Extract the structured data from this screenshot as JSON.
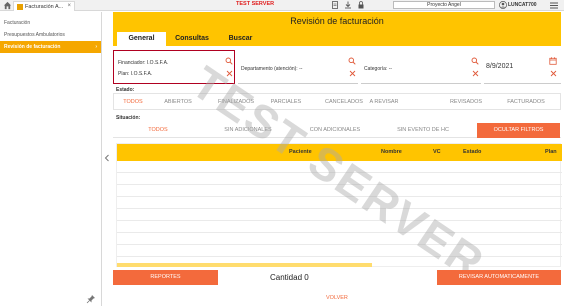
{
  "topbar": {
    "tab_label": "Facturación A...",
    "tab_close": "×",
    "server_label": "TEST SERVER",
    "project": "Proyecto Angel",
    "user": "LUNCAT700"
  },
  "sidebar": {
    "items": [
      {
        "label": "Facturación"
      },
      {
        "label": "Presupuestos Ambulatorios"
      },
      {
        "label": "Revisión de facturación",
        "arrow": "›"
      }
    ]
  },
  "main": {
    "title": "Revisión de facturación",
    "tabs": [
      {
        "label": "General"
      },
      {
        "label": "Consultas"
      },
      {
        "label": "Buscar"
      }
    ]
  },
  "filters": {
    "financiador": "Financiador: I.O.S.F.A.",
    "plan": "Plan: I.O.S.F.A.",
    "departamento": "Departamento (atención): --",
    "categoria": "Categoría: --",
    "fecha": "8/9/2021"
  },
  "estado": {
    "label": "Estado:",
    "options": [
      "TODOS",
      "ABIERTOS",
      "FINALIZADOS",
      "PARCIALES",
      "CANCELADOS",
      "A REVISAR",
      "REVISADOS",
      "FACTURADOS"
    ]
  },
  "situacion": {
    "label": "Situación:",
    "options": [
      "TODOS",
      "SIN ADICIONALES",
      "CON ADICIONALES",
      "SIN EVENTO DE HC"
    ],
    "hide_button": "OCULTAR FILTROS"
  },
  "table": {
    "columns": [
      "Paciente",
      "Nombre",
      "VC",
      "Estado",
      "Plan"
    ]
  },
  "footer": {
    "reportes": "REPORTES",
    "cantidad": "Cantidad 0",
    "revisar": "REVISAR AUTOMATICAMENTE",
    "volver": "VOLVER"
  },
  "watermark": "TEST SERVER",
  "colors": {
    "accent": "#ffc400",
    "primary_button": "#f36a3c",
    "active_option": "#f36a3c",
    "sidebar_active": "#f5a700",
    "server_label": "#e02020"
  },
  "icons": [
    "home-icon",
    "app-icon",
    "document-icon",
    "download-icon",
    "lock-icon",
    "user-icon",
    "menu-icon",
    "search-icon",
    "close-icon",
    "calendar-icon",
    "pin-icon",
    "chevron-left-icon"
  ]
}
